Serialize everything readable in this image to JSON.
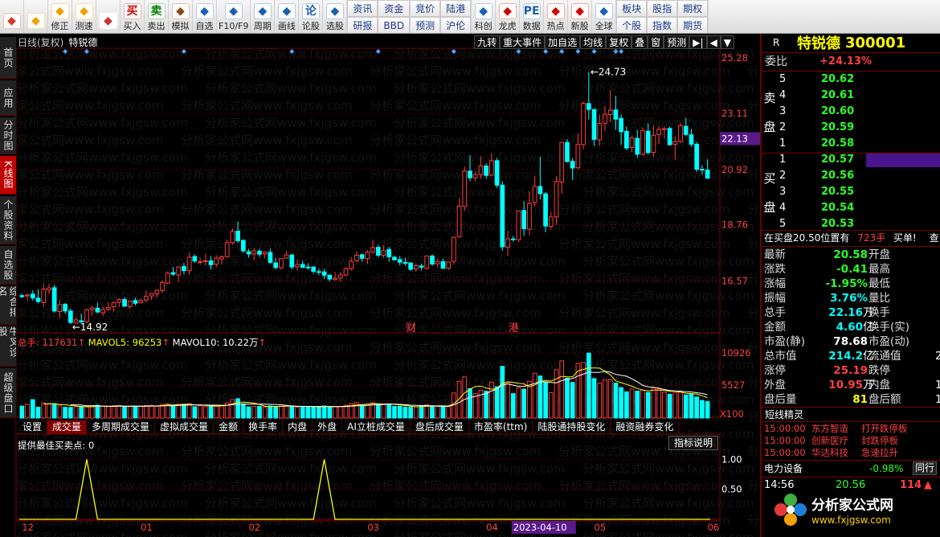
{
  "toolbar": {
    "buttons": [
      {
        "icon": "grid-icon",
        "label": "",
        "color": "#d23a2a"
      },
      {
        "icon": "back-arrow-icon",
        "label": "",
        "color": "#f0a000"
      },
      {
        "icon": "up-down-icon",
        "label": "修正",
        "color": "#f0a000"
      },
      {
        "icon": "smile-icon",
        "label": "测速",
        "color": "#f0a000"
      },
      {
        "icon": "clock-icon",
        "label": "",
        "color": "#c33"
      },
      {
        "icon": "buy-icon",
        "label": "买入",
        "glyph": "买",
        "color": "#d00000"
      },
      {
        "icon": "sell-icon",
        "label": "卖出",
        "glyph": "卖",
        "color": "#008000"
      },
      {
        "icon": "hammer-icon",
        "label": "模拟",
        "color": "#8a4b16"
      },
      {
        "icon": "star-icon",
        "label": "自选",
        "color": "#1b5fb0"
      },
      {
        "icon": "f10-icon",
        "label": "F10/F9",
        "color": "#1b5fb0"
      },
      {
        "icon": "cycle-icon",
        "label": "周期",
        "color": "#1b5fb0"
      },
      {
        "icon": "pen-icon",
        "label": "画线",
        "color": "#1b5fb0"
      },
      {
        "icon": "comment-icon",
        "label": "论股",
        "glyph": "论",
        "color": "#1b5fb0"
      },
      {
        "icon": "search-stock-icon",
        "label": "选股",
        "color": "#1b5fb0"
      }
    ],
    "grid1": [
      "资讯",
      "资金",
      "竞价",
      "陆港",
      "研报",
      "BBD",
      "预测",
      "沪伦"
    ],
    "buttons2": [
      {
        "icon": "chart-icon",
        "label": "科创",
        "color": "#1b5fb0"
      },
      {
        "icon": "dragon-icon",
        "label": "龙虎",
        "color": "#d00000"
      },
      {
        "icon": "pe-icon",
        "label": "数据",
        "glyph": "PE",
        "color": "#1b5fb0"
      },
      {
        "icon": "hot-icon",
        "label": "热点",
        "color": "#d00000"
      },
      {
        "icon": "new-stock-icon",
        "label": "新股",
        "color": "#d00000"
      },
      {
        "icon": "globe-icon",
        "label": "全球",
        "color": "#1b5fb0"
      }
    ],
    "grid2": [
      "板块",
      "股指",
      "期权",
      "个股",
      "指数",
      "期货"
    ]
  },
  "sidebar": {
    "tabs": [
      "首页",
      "应用",
      "分时图",
      "K线图",
      "个股资料",
      "自选股",
      "综合排名",
      "牛叉诊股",
      "超级盘口"
    ]
  },
  "kline": {
    "title": "日线(复权)",
    "stock": "特锐德",
    "buttons": [
      "九转",
      "重大事件",
      "加自选",
      "均线",
      "复权",
      "叠",
      "窗",
      "预测",
      "▶|",
      "◀",
      "▼"
    ],
    "price_ticks": [
      "25.28",
      "23.11",
      "20.92",
      "18.76",
      "16.57"
    ],
    "current_price_label": "22.13",
    "high_label": "←24.73",
    "low_label": "←14.92",
    "events": [
      "财",
      "港"
    ]
  },
  "volume": {
    "label_total": "总手: 117631",
    "label_ma5": "MAVOL5: 96253",
    "label_ma10": "MAVOL10: 10.22万",
    "ticks": [
      "10926",
      "5527",
      "X100"
    ]
  },
  "indicator_tabs": [
    "设置",
    "成交量",
    "多周期成交量",
    "虚拟成交量",
    "金额",
    "换手率",
    "内盘",
    "外盘",
    "AI立桩成交量",
    "盘后成交量",
    "市盈率(ttm)",
    "陆股通持股变化",
    "融资融券变化"
  ],
  "indicator": {
    "legend": "提供最佳买卖点: 0",
    "explain_button": "指标说明",
    "ticks": [
      "1.00",
      "0.50"
    ]
  },
  "x_axis": {
    "labels": [
      "12",
      "01",
      "02",
      "03",
      "04",
      "2023-04-10",
      "05",
      "06"
    ]
  },
  "watermark": "分析家公式网www.fxjgsw.com",
  "chart_data": {
    "type": "candlestick",
    "ylim": [
      14.6,
      25.6
    ],
    "ohlc": [
      [
        15.99,
        16.06,
        15.9,
        15.95
      ],
      [
        15.98,
        16.06,
        15.78,
        16.02
      ],
      [
        16.05,
        16.2,
        15.8,
        15.9
      ],
      [
        15.89,
        16.24,
        15.69,
        15.76
      ],
      [
        15.72,
        16.46,
        15.54,
        16.25
      ],
      [
        16.21,
        16.45,
        16.06,
        16.29
      ],
      [
        16.3,
        16.42,
        15.33,
        15.39
      ],
      [
        15.37,
        15.81,
        15.12,
        15.64
      ],
      [
        15.66,
        15.69,
        15.28,
        15.39
      ],
      [
        15.39,
        15.48,
        14.88,
        14.94
      ],
      [
        14.92,
        15.15,
        14.89,
        15.04
      ],
      [
        15.01,
        15.28,
        14.92,
        14.96
      ],
      [
        14.97,
        15.49,
        14.91,
        15.44
      ],
      [
        15.44,
        15.59,
        15.22,
        15.51
      ],
      [
        15.5,
        15.72,
        15.31,
        15.35
      ],
      [
        15.32,
        15.57,
        15.18,
        15.44
      ],
      [
        15.46,
        15.74,
        15.38,
        15.53
      ],
      [
        15.56,
        15.76,
        15.37,
        15.72
      ],
      [
        15.73,
        15.88,
        15.55,
        15.84
      ],
      [
        15.84,
        15.92,
        15.55,
        15.58
      ],
      [
        15.57,
        15.8,
        15.48,
        15.78
      ],
      [
        15.8,
        15.91,
        15.61,
        15.69
      ],
      [
        15.71,
        15.87,
        15.69,
        15.8
      ],
      [
        15.82,
        16.2,
        15.72,
        15.96
      ],
      [
        15.98,
        16.1,
        15.82,
        16.07
      ],
      [
        16.06,
        16.23,
        15.92,
        16.2
      ],
      [
        16.19,
        16.58,
        16.09,
        16.5
      ],
      [
        16.48,
        16.95,
        16.43,
        16.87
      ],
      [
        16.89,
        17.11,
        16.76,
        16.83
      ],
      [
        16.8,
        17.15,
        16.51,
        17.11
      ],
      [
        17.13,
        17.27,
        16.83,
        16.97
      ],
      [
        16.97,
        17.68,
        16.81,
        17.49
      ],
      [
        17.52,
        17.6,
        17.27,
        17.34
      ],
      [
        17.31,
        17.49,
        17.2,
        17.32
      ],
      [
        17.32,
        17.64,
        17.17,
        17.35
      ],
      [
        17.35,
        17.54,
        17.01,
        17.2
      ],
      [
        17.22,
        17.57,
        17.1,
        17.46
      ],
      [
        17.43,
        17.56,
        17.22,
        17.51
      ],
      [
        17.51,
        18.19,
        17.48,
        18.06
      ],
      [
        18.06,
        18.62,
        17.98,
        18.5
      ],
      [
        18.51,
        18.88,
        18.04,
        18.14
      ],
      [
        18.15,
        18.19,
        17.66,
        17.74
      ],
      [
        17.71,
        17.82,
        17.48,
        17.62
      ],
      [
        17.62,
        17.84,
        17.38,
        17.74
      ],
      [
        17.73,
        17.82,
        17.51,
        17.61
      ],
      [
        17.62,
        17.73,
        17.45,
        17.69
      ],
      [
        17.68,
        17.83,
        17.23,
        17.29
      ],
      [
        17.27,
        17.47,
        17.01,
        17.09
      ],
      [
        17.08,
        17.45,
        17.01,
        17.44
      ],
      [
        17.46,
        17.74,
        17.45,
        17.58
      ],
      [
        17.58,
        17.62,
        17.01,
        17.11
      ],
      [
        17.12,
        17.39,
        16.97,
        17.2
      ],
      [
        17.21,
        17.35,
        17.08,
        17.09
      ],
      [
        17.11,
        17.26,
        17.01,
        17.08
      ],
      [
        17.11,
        17.14,
        16.84,
        16.94
      ],
      [
        16.93,
        17.05,
        16.8,
        16.92
      ],
      [
        16.92,
        17.04,
        16.64,
        16.79
      ],
      [
        16.79,
        16.82,
        16.55,
        16.64
      ],
      [
        16.62,
        16.92,
        16.58,
        16.67
      ],
      [
        16.68,
        16.92,
        16.53,
        16.8
      ],
      [
        16.8,
        17.12,
        16.74,
        17.04
      ],
      [
        17.04,
        17.5,
        16.97,
        17.33
      ],
      [
        17.36,
        17.73,
        17.29,
        17.57
      ],
      [
        17.59,
        17.63,
        17.32,
        17.45
      ],
      [
        17.44,
        17.77,
        17.23,
        17.69
      ],
      [
        17.7,
        18.16,
        17.62,
        17.87
      ],
      [
        17.88,
        17.97,
        17.49,
        17.57
      ],
      [
        17.57,
        17.96,
        17.46,
        17.75
      ],
      [
        17.79,
        17.89,
        17.32,
        17.51
      ],
      [
        17.49,
        17.56,
        17.37,
        17.39
      ],
      [
        17.4,
        17.54,
        17.18,
        17.3
      ],
      [
        17.29,
        17.47,
        17.16,
        17.28
      ],
      [
        17.27,
        17.29,
        16.95,
        17.02
      ],
      [
        17.03,
        17.24,
        16.93,
        17.16
      ],
      [
        17.15,
        17.24,
        16.98,
        17.1
      ],
      [
        17.06,
        17.55,
        17.01,
        17.54
      ],
      [
        17.54,
        17.6,
        17.16,
        17.23
      ],
      [
        17.24,
        17.44,
        17.09,
        17.33
      ],
      [
        17.32,
        17.43,
        17.03,
        17.06
      ],
      [
        17.07,
        17.32,
        16.98,
        17.3
      ],
      [
        17.33,
        18.3,
        17.22,
        18.27
      ],
      [
        18.29,
        19.82,
        18.26,
        19.49
      ],
      [
        19.48,
        21.03,
        19.32,
        20.86
      ],
      [
        20.86,
        21.48,
        20.46,
        20.6
      ],
      [
        20.6,
        20.85,
        20.45,
        20.72
      ],
      [
        20.73,
        21.41,
        20.56,
        21.06
      ],
      [
        21.06,
        21.16,
        20.56,
        20.69
      ],
      [
        20.7,
        21.55,
        20.65,
        21.26
      ],
      [
        21.27,
        21.38,
        20.2,
        20.31
      ],
      [
        20.31,
        20.46,
        17.74,
        17.9
      ],
      [
        17.89,
        18.53,
        17.55,
        18.21
      ],
      [
        18.21,
        18.33,
        18.1,
        18.18
      ],
      [
        18.18,
        19.3,
        18.09,
        19.3
      ],
      [
        19.32,
        19.69,
        18.33,
        18.61
      ],
      [
        18.59,
        20.07,
        18.35,
        19.6
      ],
      [
        19.63,
        20.65,
        19.47,
        20.26
      ],
      [
        20.26,
        21.42,
        19.76,
        19.98
      ],
      [
        19.97,
        20.04,
        18.47,
        18.71
      ],
      [
        18.7,
        19.26,
        18.6,
        19.07
      ],
      [
        19.07,
        20.67,
        18.76,
        20.46
      ],
      [
        20.43,
        22.0,
        19.98,
        21.98
      ],
      [
        21.98,
        22.11,
        21.2,
        21.23
      ],
      [
        21.24,
        21.37,
        20.51,
        20.98
      ],
      [
        20.99,
        22.33,
        20.94,
        21.9
      ],
      [
        21.9,
        23.57,
        21.71,
        23.51
      ],
      [
        23.5,
        24.73,
        22.88,
        23.27
      ],
      [
        23.27,
        23.29,
        21.84,
        22.1
      ],
      [
        22.08,
        23.06,
        21.84,
        22.72
      ],
      [
        22.73,
        23.4,
        22.42,
        23.08
      ],
      [
        23.07,
        24.02,
        22.77,
        23.24
      ],
      [
        23.25,
        23.81,
        22.47,
        22.89
      ],
      [
        22.92,
        23.07,
        21.88,
        22.4
      ],
      [
        22.41,
        22.59,
        21.68,
        21.76
      ],
      [
        21.78,
        22.25,
        21.6,
        22.15
      ],
      [
        22.14,
        22.47,
        21.38,
        21.52
      ],
      [
        21.52,
        22.55,
        21.46,
        22.44
      ],
      [
        22.42,
        22.73,
        21.52,
        21.58
      ],
      [
        21.59,
        22.64,
        21.41,
        22.26
      ],
      [
        22.29,
        22.62,
        21.92,
        22.49
      ],
      [
        22.48,
        22.62,
        22.14,
        22.52
      ],
      [
        22.53,
        22.6,
        21.86,
        21.89
      ],
      [
        21.91,
        22.22,
        21.29,
        22.01
      ],
      [
        22.02,
        22.74,
        21.96,
        22.63
      ],
      [
        22.61,
        22.94,
        22.22,
        22.29
      ],
      [
        22.28,
        22.51,
        21.81,
        21.91
      ],
      [
        21.91,
        21.99,
        20.83,
        20.93
      ],
      [
        20.93,
        21.09,
        20.73,
        20.9
      ],
      [
        20.9,
        21.32,
        20.66,
        20.58
      ]
    ],
    "volume": [
      2012,
      2315,
      3094,
      1819,
      2540,
      2314,
      2410,
      2175,
      1824,
      1783,
      1930,
      1950,
      2007,
      1883,
      2160,
      1989,
      1973,
      2076,
      2092,
      1883,
      1916,
      2020,
      1950,
      2108,
      2143,
      2001,
      2301,
      2391,
      2169,
      2309,
      2314,
      2395,
      1893,
      2065,
      1920,
      1957,
      2179,
      2116,
      2542,
      3083,
      3254,
      2379,
      1884,
      1972,
      1956,
      1844,
      2031,
      1960,
      2016,
      2109,
      2049,
      1812,
      1889,
      1943,
      1822,
      1832,
      2024,
      1887,
      1966,
      1955,
      2139,
      2407,
      2592,
      2242,
      2319,
      2550,
      2311,
      2362,
      2340,
      1954,
      1968,
      1841,
      1811,
      1887,
      2081,
      2264,
      2060,
      1966,
      1895,
      1929,
      4218,
      6193,
      6921,
      4952,
      4137,
      4690,
      4510,
      6013,
      5280,
      8700,
      5963,
      4110,
      5110,
      4860,
      6190,
      7540,
      7070,
      6002,
      4250,
      8150,
      9620,
      6710,
      5990,
      9210,
      9350,
      10926,
      6650,
      5860,
      6410,
      6460,
      5890,
      5120,
      4410,
      4870,
      4540,
      4690,
      4310,
      5030,
      4900,
      4330,
      4010,
      4310,
      4340,
      3890,
      4010,
      3550,
      2970,
      2780
    ],
    "volume_ylim": [
      0,
      11500
    ],
    "indicator_signal": [
      0,
      0,
      0,
      0,
      0,
      0,
      0,
      0,
      0,
      0,
      0,
      0,
      0,
      0,
      0,
      0,
      0,
      0,
      0,
      0,
      0,
      0,
      0,
      0,
      0,
      0,
      0,
      0,
      0,
      0,
      0,
      0,
      0,
      0,
      0,
      0,
      0,
      0,
      0,
      0,
      0,
      0,
      0,
      0,
      0,
      0,
      0,
      0,
      0,
      0,
      0,
      0,
      0,
      0,
      0,
      0,
      0,
      0,
      0,
      0,
      0,
      0,
      0,
      0,
      0,
      0,
      0,
      0,
      0,
      0,
      0,
      0,
      0,
      0,
      0,
      0,
      0,
      0,
      0,
      0,
      0,
      0,
      0,
      0,
      0,
      0,
      0,
      0,
      0,
      0,
      0,
      0,
      0,
      0,
      0,
      0,
      0,
      0,
      0,
      0,
      0,
      0,
      0,
      0,
      0,
      0,
      0,
      0,
      0,
      0,
      0,
      0,
      0,
      0,
      0,
      0,
      0,
      0,
      0,
      0,
      0,
      0,
      0,
      0,
      0,
      0,
      0,
      0,
      0,
      0,
      0
    ],
    "signal_at": [
      12,
      56
    ],
    "indicator_ylim": [
      0,
      1.1
    ],
    "event_markers": [
      {
        "label": "财",
        "index": 72
      },
      {
        "label": "港",
        "index": 91
      }
    ],
    "diamonds": [
      8,
      12,
      30,
      50,
      66,
      80,
      92,
      97,
      100,
      103,
      106,
      110,
      111
    ]
  },
  "quote": {
    "r": "R",
    "name": "特锐德",
    "code": "300001",
    "weibi_label": "委比",
    "weibi": "+24.13%",
    "sell_label": "卖盘",
    "buy_label": "买盘",
    "sell": [
      {
        "n": "5",
        "p": "20.62"
      },
      {
        "n": "4",
        "p": "20.61"
      },
      {
        "n": "3",
        "p": "20.60"
      },
      {
        "n": "2",
        "p": "20.59"
      },
      {
        "n": "1",
        "p": "20.58"
      }
    ],
    "buy": [
      {
        "n": "1",
        "p": "20.57"
      },
      {
        "n": "2",
        "p": "20.56"
      },
      {
        "n": "3",
        "p": "20.55"
      },
      {
        "n": "4",
        "p": "20.54"
      },
      {
        "n": "5",
        "p": "20.53"
      }
    ],
    "info_prefix": "在买盘20.50位置有",
    "info_vol": "723手",
    "info_suffix": "买单!",
    "info_tail": "查",
    "stats": [
      {
        "l": "最新",
        "v": "20.58",
        "c": "g",
        "r": "开盘"
      },
      {
        "l": "涨跌",
        "v": "-0.41",
        "c": "g",
        "r": "最高"
      },
      {
        "l": "涨幅",
        "v": "-1.95%",
        "c": "g",
        "r": "最低"
      },
      {
        "l": "振幅",
        "v": "3.76%",
        "c": "c",
        "r": "量比"
      },
      {
        "l": "总手",
        "v": "22.16",
        "u": "万",
        "c": "c",
        "r": "换手"
      },
      {
        "l": "金额",
        "v": "4.60",
        "u": "亿",
        "c": "c",
        "r": "换手(实)"
      },
      {
        "l": "市盈(静)",
        "v": "78.68",
        "c": "w",
        "r": "市盈(动)"
      },
      {
        "l": "总市值",
        "v": "214.2",
        "u": "亿",
        "c": "c",
        "r": "流通值",
        "rv": "2"
      },
      {
        "l": "涨停",
        "v": "25.19",
        "c": "r",
        "r": "跌停"
      },
      {
        "l": "外盘",
        "v": "10.95",
        "u": "万",
        "c": "r",
        "r": "内盘",
        "rv": "1"
      },
      {
        "l": "盘后量",
        "v": "81",
        "c": "y",
        "r": "盘后额",
        "rv": "1"
      }
    ],
    "news_title": "短线精灵",
    "news": [
      {
        "t": "15:00:00",
        "s": "东方智造",
        "e": "打开跌停板"
      },
      {
        "t": "15:00:00",
        "s": "创新医疗",
        "e": "封跌停板"
      },
      {
        "t": "15:00:00",
        "s": "华达科技",
        "e": "急速拉升"
      }
    ],
    "sector": {
      "name": "电力设备",
      "chg": "-0.98%",
      "btn": "同行"
    },
    "tick": {
      "time": "14:56",
      "price": "20.56",
      "vol": "114"
    },
    "logo": {
      "name": "分析家公式网",
      "url": "www.fxjgsw.com"
    }
  }
}
